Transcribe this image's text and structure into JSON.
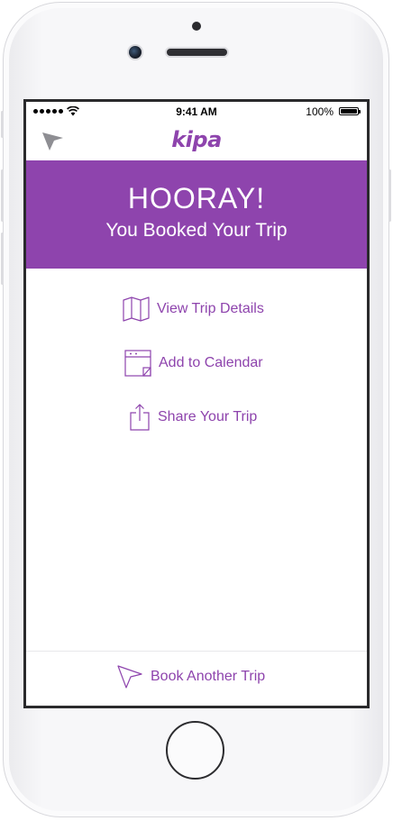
{
  "status_bar": {
    "time": "9:41 AM",
    "battery_percent": "100%"
  },
  "nav": {
    "logo_text": "kipa",
    "nav_icon": "navigation-arrow-icon"
  },
  "banner": {
    "title": "HOORAY!",
    "subtitle": "You Booked Your Trip"
  },
  "actions": [
    {
      "label": "View Trip Details",
      "icon": "map-icon"
    },
    {
      "label": "Add to Calendar",
      "icon": "calendar-icon"
    },
    {
      "label": "Share Your Trip",
      "icon": "share-icon"
    }
  ],
  "footer": {
    "label": "Book Another Trip",
    "icon": "navigation-arrow-icon"
  },
  "colors": {
    "brand_purple": "#8e44ad",
    "nav_icon_gray": "#8e8e93"
  }
}
